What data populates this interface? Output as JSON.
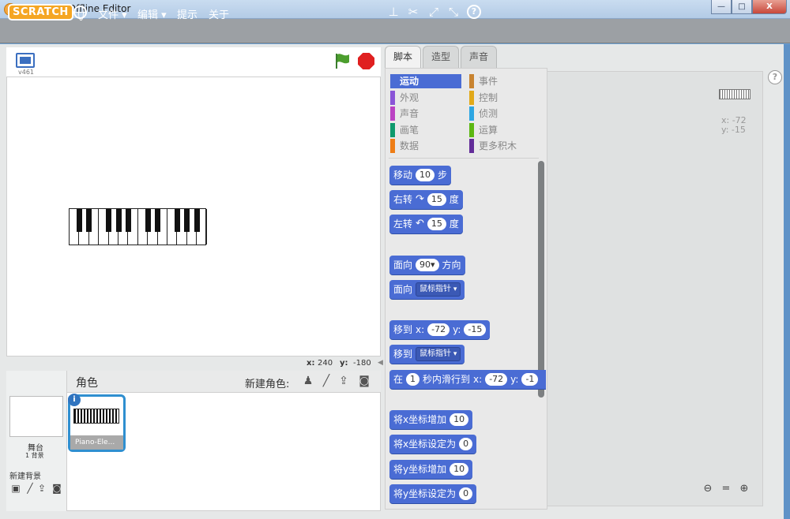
{
  "window": {
    "title": "Scratch 2 Offline Editor",
    "min": "—",
    "max": "□",
    "close": "X"
  },
  "menubar": {
    "logo": "SCRATCH",
    "items": [
      "文件 ▾",
      "编辑 ▾",
      "提示",
      "关于"
    ]
  },
  "stage": {
    "version": "v461",
    "coords": {
      "x_label": "x:",
      "x_value": "240",
      "y_label": "y:",
      "y_value": "-180"
    }
  },
  "sprites": {
    "title": "角色",
    "new_sprite_label": "新建角色:",
    "stage_label": "舞台",
    "backdrop_count": "1 背景",
    "new_backdrop_label": "新建背景",
    "sprite_name": "Piano-Ele...",
    "info": "i"
  },
  "tabs": [
    "脚本",
    "造型",
    "声音"
  ],
  "categories": [
    {
      "label": "运动",
      "color": "#4a6cd4",
      "active": true
    },
    {
      "label": "外观",
      "color": "#8a55d7"
    },
    {
      "label": "声音",
      "color": "#bb42c3"
    },
    {
      "label": "画笔",
      "color": "#0e9a6c"
    },
    {
      "label": "数据",
      "color": "#ee7d16"
    },
    {
      "label": "事件",
      "color": "#c88330"
    },
    {
      "label": "控制",
      "color": "#e1a91a"
    },
    {
      "label": "侦测",
      "color": "#2ca5e2"
    },
    {
      "label": "运算",
      "color": "#5cb712"
    },
    {
      "label": "更多积木",
      "color": "#632d99"
    }
  ],
  "blocks": {
    "move": {
      "a": "移动",
      "v": "10",
      "b": "步"
    },
    "turn_right": {
      "a": "右转",
      "icon": "↷",
      "v": "15",
      "b": "度"
    },
    "turn_left": {
      "a": "左转",
      "icon": "↶",
      "v": "15",
      "b": "度"
    },
    "point_dir": {
      "a": "面向",
      "v": "90▾",
      "b": "方向"
    },
    "point_towards": {
      "a": "面向",
      "dd": "鼠标指针"
    },
    "goto_xy": {
      "a": "移到",
      "x": "x:",
      "xv": "-72",
      "y": "y:",
      "yv": "-15"
    },
    "goto": {
      "a": "移到",
      "dd": "鼠标指针"
    },
    "glide": {
      "a": "在",
      "v": "1",
      "b": "秒内滑行到",
      "x": "x:",
      "xv": "-72",
      "y": "y:",
      "yv": "-1"
    },
    "change_x": {
      "a": "将x坐标增加",
      "v": "10"
    },
    "set_x": {
      "a": "将x坐标设定为",
      "v": "0"
    },
    "change_y": {
      "a": "将y坐标增加",
      "v": "10"
    },
    "set_y": {
      "a": "将y坐标设定为",
      "v": "0"
    }
  },
  "scripts_area": {
    "x_readout": "x: -72",
    "y_readout": "y: -15",
    "help": "?"
  }
}
